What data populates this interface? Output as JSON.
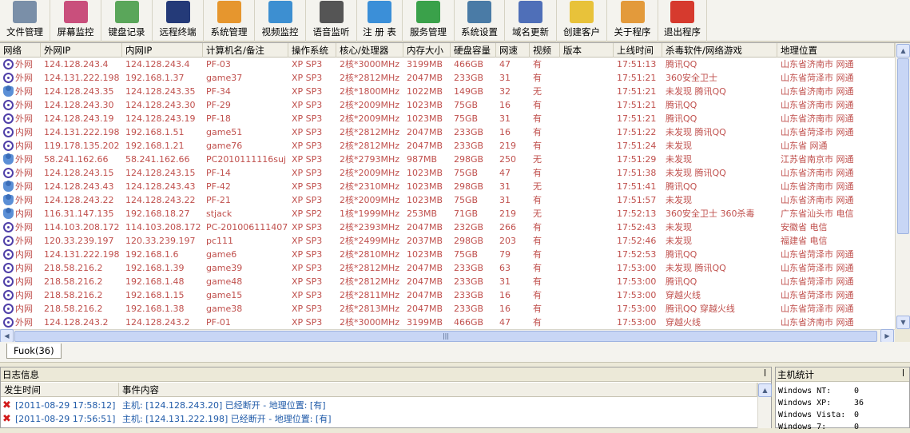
{
  "toolbar": [
    {
      "label": "文件管理",
      "icon": "file-manager-icon",
      "color": "#7a8fa8",
      "w": 63
    },
    {
      "label": "屏幕监控",
      "icon": "screen-monitor-icon",
      "color": "#c94f7c",
      "w": 64
    },
    {
      "label": "键盘记录",
      "icon": "keyboard-log-icon",
      "color": "#5aa65a",
      "w": 64
    },
    {
      "label": "远程终端",
      "icon": "remote-terminal-icon",
      "color": "#243a78",
      "w": 64
    },
    {
      "label": "系统管理",
      "icon": "system-manage-icon",
      "color": "#e6962e",
      "w": 64
    },
    {
      "label": "视频监控",
      "icon": "video-monitor-icon",
      "color": "#3d8fd1",
      "w": 64
    },
    {
      "label": "语音监听",
      "icon": "audio-listen-icon",
      "color": "#555555",
      "w": 64
    },
    {
      "label": "注 册 表",
      "icon": "registry-icon",
      "color": "#3b8fd8",
      "w": 57
    },
    {
      "label": "服务管理",
      "icon": "service-manage-icon",
      "color": "#3aa14a",
      "w": 65
    },
    {
      "label": "系统设置",
      "icon": "system-settings-icon",
      "color": "#4a7ba6",
      "w": 63
    },
    {
      "label": "域名更新",
      "icon": "domain-update-icon",
      "color": "#4f6fb8",
      "w": 65
    },
    {
      "label": "创建客户",
      "icon": "create-client-icon",
      "color": "#e8c23a",
      "w": 63
    },
    {
      "label": "关于程序",
      "icon": "about-icon",
      "color": "#e39a3b",
      "w": 64
    },
    {
      "label": "退出程序",
      "icon": "exit-icon",
      "color": "#d63a2e",
      "w": 61
    }
  ],
  "columns": [
    {
      "label": "网络",
      "w": 51
    },
    {
      "label": "外网IP",
      "w": 102
    },
    {
      "label": "内网IP",
      "w": 101
    },
    {
      "label": "计算机名/备注",
      "w": 107
    },
    {
      "label": "操作系统",
      "w": 60
    },
    {
      "label": "核心/处理器",
      "w": 84
    },
    {
      "label": "内存大小",
      "w": 59
    },
    {
      "label": "硬盘容量",
      "w": 57
    },
    {
      "label": "网速",
      "w": 42
    },
    {
      "label": "视频",
      "w": 38
    },
    {
      "label": "版本",
      "w": 67
    },
    {
      "label": "上线时间",
      "w": 61
    },
    {
      "label": "杀毒软件/网络游戏",
      "w": 144
    },
    {
      "label": "地理位置",
      "w": 147
    }
  ],
  "rows": [
    {
      "icon": "ring",
      "net": "外网",
      "wan": "124.128.243.4",
      "lan": "124.128.243.4",
      "name": "PF-03",
      "os": "XP SP3",
      "cpu": "2核*3000MHz",
      "mem": "3199MB",
      "disk": "466GB",
      "speed": "47",
      "video": "有",
      "ver": "",
      "time": "17:51:13",
      "av": "腾讯QQ",
      "loc": "山东省济南市 网通"
    },
    {
      "icon": "ring",
      "net": "外网",
      "wan": "124.131.222.198",
      "lan": "192.168.1.37",
      "name": "game37",
      "os": "XP SP3",
      "cpu": "2核*2812MHz",
      "mem": "2047MB",
      "disk": "233GB",
      "speed": "31",
      "video": "有",
      "ver": "",
      "time": "17:51:21",
      "av": "360安全卫士",
      "loc": "山东省菏泽市 网通"
    },
    {
      "icon": "person",
      "net": "外网",
      "wan": "124.128.243.35",
      "lan": "124.128.243.35",
      "name": "PF-34",
      "os": "XP SP3",
      "cpu": "2核*1800MHz",
      "mem": "1022MB",
      "disk": "149GB",
      "speed": "32",
      "video": "无",
      "ver": "",
      "time": "17:51:21",
      "av": "未发现 腾讯QQ",
      "loc": "山东省济南市 网通"
    },
    {
      "icon": "ring",
      "net": "外网",
      "wan": "124.128.243.30",
      "lan": "124.128.243.30",
      "name": "PF-29",
      "os": "XP SP3",
      "cpu": "2核*2009MHz",
      "mem": "1023MB",
      "disk": "75GB",
      "speed": "16",
      "video": "有",
      "ver": "",
      "time": "17:51:21",
      "av": "腾讯QQ",
      "loc": "山东省济南市 网通"
    },
    {
      "icon": "ring",
      "net": "外网",
      "wan": "124.128.243.19",
      "lan": "124.128.243.19",
      "name": "PF-18",
      "os": "XP SP3",
      "cpu": "2核*2009MHz",
      "mem": "1023MB",
      "disk": "75GB",
      "speed": "31",
      "video": "有",
      "ver": "",
      "time": "17:51:21",
      "av": "腾讯QQ",
      "loc": "山东省济南市 网通"
    },
    {
      "icon": "ring",
      "net": "内网",
      "wan": "124.131.222.198",
      "lan": "192.168.1.51",
      "name": "game51",
      "os": "XP SP3",
      "cpu": "2核*2812MHz",
      "mem": "2047MB",
      "disk": "233GB",
      "speed": "16",
      "video": "有",
      "ver": "",
      "time": "17:51:22",
      "av": "未发现 腾讯QQ",
      "loc": "山东省菏泽市 网通"
    },
    {
      "icon": "ring",
      "net": "内网",
      "wan": "119.178.135.202",
      "lan": "192.168.1.21",
      "name": "game76",
      "os": "XP SP3",
      "cpu": "2核*2812MHz",
      "mem": "2047MB",
      "disk": "233GB",
      "speed": "219",
      "video": "有",
      "ver": "",
      "time": "17:51:24",
      "av": "未发现",
      "loc": "山东省 网通"
    },
    {
      "icon": "person",
      "net": "外网",
      "wan": "58.241.162.66",
      "lan": "58.241.162.66",
      "name": "PC2010111116suj",
      "os": "XP SP3",
      "cpu": "2核*2793MHz",
      "mem": "987MB",
      "disk": "298GB",
      "speed": "250",
      "video": "无",
      "ver": "",
      "time": "17:51:29",
      "av": "未发现",
      "loc": "江苏省南京市 网通"
    },
    {
      "icon": "ring",
      "net": "外网",
      "wan": "124.128.243.15",
      "lan": "124.128.243.15",
      "name": "PF-14",
      "os": "XP SP3",
      "cpu": "2核*2009MHz",
      "mem": "1023MB",
      "disk": "75GB",
      "speed": "47",
      "video": "有",
      "ver": "",
      "time": "17:51:38",
      "av": "未发现 腾讯QQ",
      "loc": "山东省济南市 网通"
    },
    {
      "icon": "person",
      "net": "外网",
      "wan": "124.128.243.43",
      "lan": "124.128.243.43",
      "name": "PF-42",
      "os": "XP SP3",
      "cpu": "2核*2310MHz",
      "mem": "1023MB",
      "disk": "298GB",
      "speed": "31",
      "video": "无",
      "ver": "",
      "time": "17:51:41",
      "av": "腾讯QQ",
      "loc": "山东省济南市 网通"
    },
    {
      "icon": "person",
      "net": "外网",
      "wan": "124.128.243.22",
      "lan": "124.128.243.22",
      "name": "PF-21",
      "os": "XP SP3",
      "cpu": "2核*2009MHz",
      "mem": "1023MB",
      "disk": "75GB",
      "speed": "31",
      "video": "有",
      "ver": "",
      "time": "17:51:57",
      "av": "未发现",
      "loc": "山东省济南市 网通"
    },
    {
      "icon": "person",
      "net": "内网",
      "wan": "116.31.147.135",
      "lan": "192.168.18.27",
      "name": "stjack",
      "os": "XP SP2",
      "cpu": "1核*1999MHz",
      "mem": "253MB",
      "disk": "71GB",
      "speed": "219",
      "video": "无",
      "ver": "",
      "time": "17:52:13",
      "av": "360安全卫士 360杀毒",
      "loc": "广东省汕头市 电信"
    },
    {
      "icon": "ring",
      "net": "外网",
      "wan": "114.103.208.172",
      "lan": "114.103.208.172",
      "name": "PC-201006111407",
      "os": "XP SP3",
      "cpu": "2核*2393MHz",
      "mem": "2047MB",
      "disk": "232GB",
      "speed": "266",
      "video": "有",
      "ver": "",
      "time": "17:52:43",
      "av": "未发现",
      "loc": "安徽省 电信"
    },
    {
      "icon": "ring",
      "net": "外网",
      "wan": "120.33.239.197",
      "lan": "120.33.239.197",
      "name": "pc111",
      "os": "XP SP3",
      "cpu": "2核*2499MHz",
      "mem": "2037MB",
      "disk": "298GB",
      "speed": "203",
      "video": "有",
      "ver": "",
      "time": "17:52:46",
      "av": "未发现",
      "loc": "福建省 电信"
    },
    {
      "icon": "ring",
      "net": "内网",
      "wan": "124.131.222.198",
      "lan": "192.168.1.6",
      "name": "game6",
      "os": "XP SP3",
      "cpu": "2核*2810MHz",
      "mem": "1023MB",
      "disk": "75GB",
      "speed": "79",
      "video": "有",
      "ver": "",
      "time": "17:52:53",
      "av": "腾讯QQ",
      "loc": "山东省菏泽市 网通"
    },
    {
      "icon": "ring",
      "net": "内网",
      "wan": "218.58.216.2",
      "lan": "192.168.1.39",
      "name": "game39",
      "os": "XP SP3",
      "cpu": "2核*2812MHz",
      "mem": "2047MB",
      "disk": "233GB",
      "speed": "63",
      "video": "有",
      "ver": "",
      "time": "17:53:00",
      "av": "未发现 腾讯QQ",
      "loc": "山东省菏泽市 网通"
    },
    {
      "icon": "ring",
      "net": "内网",
      "wan": "218.58.216.2",
      "lan": "192.168.1.48",
      "name": "game48",
      "os": "XP SP3",
      "cpu": "2核*2812MHz",
      "mem": "2047MB",
      "disk": "233GB",
      "speed": "31",
      "video": "有",
      "ver": "",
      "time": "17:53:00",
      "av": "腾讯QQ",
      "loc": "山东省菏泽市 网通"
    },
    {
      "icon": "ring",
      "net": "内网",
      "wan": "218.58.216.2",
      "lan": "192.168.1.15",
      "name": "game15",
      "os": "XP SP3",
      "cpu": "2核*2811MHz",
      "mem": "2047MB",
      "disk": "233GB",
      "speed": "16",
      "video": "有",
      "ver": "",
      "time": "17:53:00",
      "av": "穿越火线",
      "loc": "山东省菏泽市 网通"
    },
    {
      "icon": "ring",
      "net": "内网",
      "wan": "218.58.216.2",
      "lan": "192.168.1.38",
      "name": "game38",
      "os": "XP SP3",
      "cpu": "2核*2813MHz",
      "mem": "2047MB",
      "disk": "233GB",
      "speed": "16",
      "video": "有",
      "ver": "",
      "time": "17:53:00",
      "av": "腾讯QQ 穿越火线",
      "loc": "山东省菏泽市 网通"
    },
    {
      "icon": "ring",
      "net": "外网",
      "wan": "124.128.243.2",
      "lan": "124.128.243.2",
      "name": "PF-01",
      "os": "XP SP3",
      "cpu": "2核*3000MHz",
      "mem": "3199MB",
      "disk": "466GB",
      "speed": "47",
      "video": "有",
      "ver": "",
      "time": "17:53:00",
      "av": "穿越火线",
      "loc": "山东省济南市 网通"
    }
  ],
  "tab": {
    "label": "Fuok(36)"
  },
  "log": {
    "title": "日志信息",
    "col_time": "发生时间",
    "col_event": "事件内容",
    "rows": [
      {
        "time": "[2011-08-29 17:58:12]",
        "event": "主机: [124.128.243.20] 已经断开 - 地理位置: [有]"
      },
      {
        "time": "[2011-08-29 17:56:51]",
        "event": "主机: [124.131.222.198] 已经断开 - 地理位置: [有]"
      }
    ]
  },
  "stats": {
    "title": "主机统计",
    "rows": [
      {
        "label": "Windows NT:",
        "value": "0"
      },
      {
        "label": "Windows XP:",
        "value": "36"
      },
      {
        "label": "Windows Vista:",
        "value": "0"
      },
      {
        "label": "Windows 7:",
        "value": "0"
      }
    ]
  },
  "colors": {
    "row_text": "#c0504d",
    "log_text": "#1f5aa8",
    "error": "#d21b1b"
  }
}
